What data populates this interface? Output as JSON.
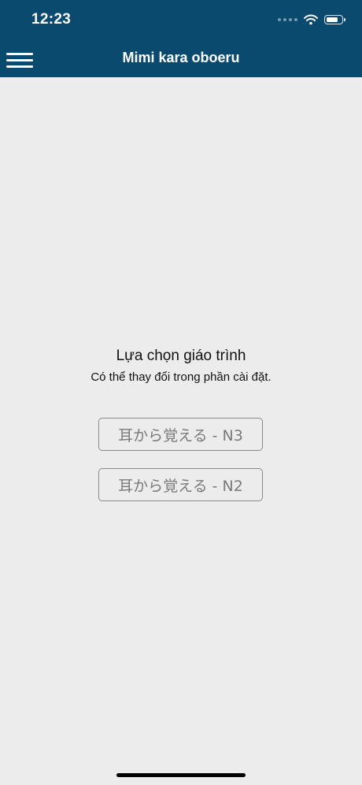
{
  "status_bar": {
    "time": "12:23",
    "battery_level": 0.75
  },
  "nav": {
    "title": "Mimi kara oboeru",
    "menu_icon": "hamburger-menu-icon"
  },
  "selection": {
    "heading": "Lựa chọn giáo trình",
    "subheading": "Có thể thay đổi trong phần cài đặt.",
    "options": [
      {
        "label": "耳から覚える - N3"
      },
      {
        "label": "耳から覚える - N2"
      }
    ]
  },
  "colors": {
    "header_background": "#0b4a6f",
    "page_background": "#ececec",
    "button_border": "#8a8a8a",
    "button_text": "#7a7a7a"
  }
}
